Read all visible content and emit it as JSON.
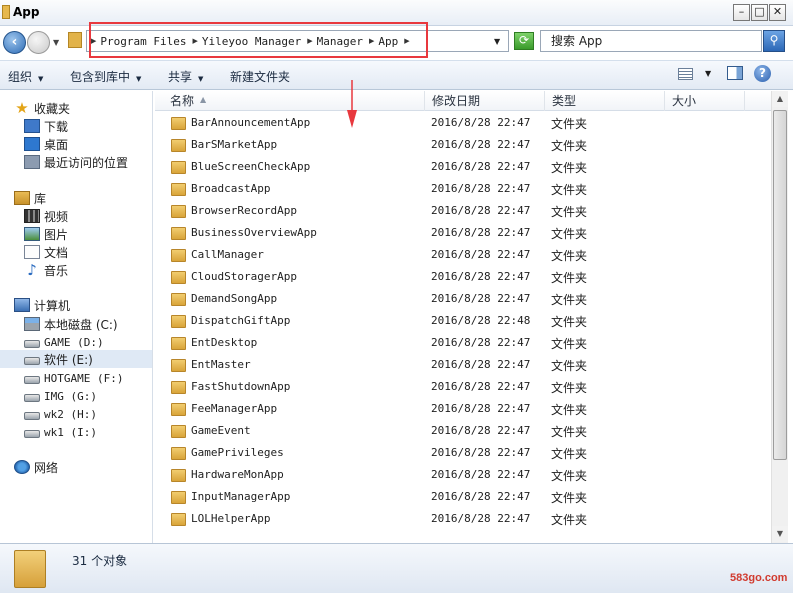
{
  "window": {
    "title": "App"
  },
  "address": {
    "crumbs": [
      "Program Files",
      "Yileyoo Manager",
      "Manager",
      "App"
    ],
    "search_placeholder": "搜索 App"
  },
  "toolbar": {
    "organize": "组织",
    "include_library": "包含到库中",
    "share": "共享",
    "new_folder": "新建文件夹"
  },
  "navpane": {
    "favorites": "收藏夹",
    "downloads": "下载",
    "desktop": "桌面",
    "recent": "最近访问的位置",
    "libraries": "库",
    "videos": "视频",
    "pictures": "图片",
    "documents": "文档",
    "music": "音乐",
    "computer": "计算机",
    "drive_c": "本地磁盘 (C:)",
    "drive_d": "GAME (D:)",
    "drive_e": "软件 (E:)",
    "drive_f": "HOTGAME (F:)",
    "drive_g": "IMG (G:)",
    "drive_h": "wk2 (H:)",
    "drive_i": "wk1 (I:)",
    "network": "网络"
  },
  "columns": {
    "name": "名称",
    "modified": "修改日期",
    "type": "类型",
    "size": "大小"
  },
  "files": [
    {
      "name": "BarAnnouncementApp",
      "date": "2016/8/28 22:47",
      "type": "文件夹"
    },
    {
      "name": "BarSMarketApp",
      "date": "2016/8/28 22:47",
      "type": "文件夹"
    },
    {
      "name": "BlueScreenCheckApp",
      "date": "2016/8/28 22:47",
      "type": "文件夹"
    },
    {
      "name": "BroadcastApp",
      "date": "2016/8/28 22:47",
      "type": "文件夹"
    },
    {
      "name": "BrowserRecordApp",
      "date": "2016/8/28 22:47",
      "type": "文件夹"
    },
    {
      "name": "BusinessOverviewApp",
      "date": "2016/8/28 22:47",
      "type": "文件夹"
    },
    {
      "name": "CallManager",
      "date": "2016/8/28 22:47",
      "type": "文件夹"
    },
    {
      "name": "CloudStoragerApp",
      "date": "2016/8/28 22:47",
      "type": "文件夹"
    },
    {
      "name": "DemandSongApp",
      "date": "2016/8/28 22:47",
      "type": "文件夹"
    },
    {
      "name": "DispatchGiftApp",
      "date": "2016/8/28 22:48",
      "type": "文件夹"
    },
    {
      "name": "EntDesktop",
      "date": "2016/8/28 22:47",
      "type": "文件夹"
    },
    {
      "name": "EntMaster",
      "date": "2016/8/28 22:47",
      "type": "文件夹"
    },
    {
      "name": "FastShutdownApp",
      "date": "2016/8/28 22:47",
      "type": "文件夹"
    },
    {
      "name": "FeeManagerApp",
      "date": "2016/8/28 22:47",
      "type": "文件夹"
    },
    {
      "name": "GameEvent",
      "date": "2016/8/28 22:47",
      "type": "文件夹"
    },
    {
      "name": "GamePrivileges",
      "date": "2016/8/28 22:47",
      "type": "文件夹"
    },
    {
      "name": "HardwareMonApp",
      "date": "2016/8/28 22:47",
      "type": "文件夹"
    },
    {
      "name": "InputManagerApp",
      "date": "2016/8/28 22:47",
      "type": "文件夹"
    },
    {
      "name": "LOLHelperApp",
      "date": "2016/8/28 22:47",
      "type": "文件夹"
    }
  ],
  "status": {
    "count": "31 个对象"
  },
  "watermark": "583go.com",
  "colors": {
    "annotation": "#e8383e",
    "selection": "#dfe9f5"
  }
}
